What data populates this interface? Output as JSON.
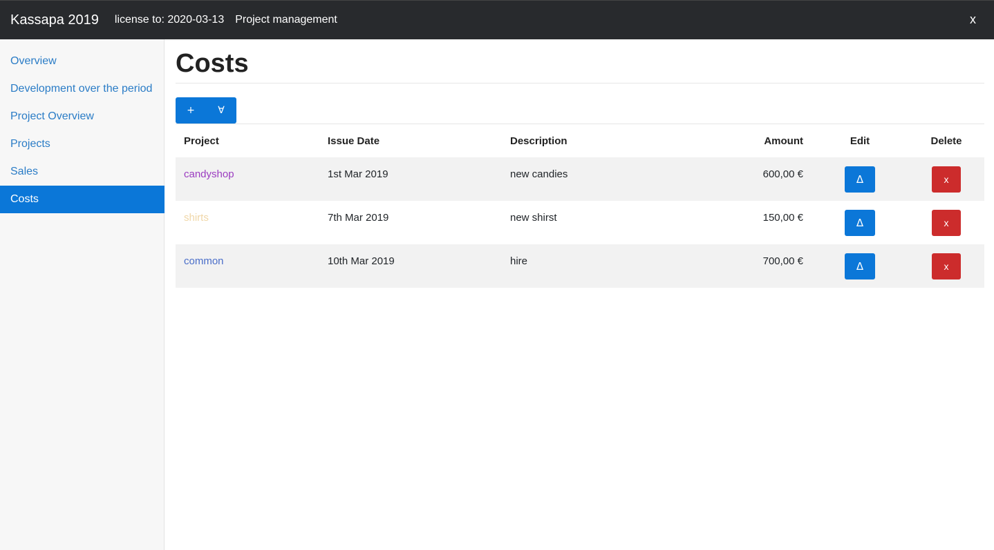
{
  "navbar": {
    "brand": "Kassapa 2019",
    "license": "license to: 2020-03-13",
    "module": "Project management",
    "close_label": "x"
  },
  "sidebar": {
    "items": [
      {
        "label": "Overview"
      },
      {
        "label": "Development over the period"
      },
      {
        "label": "Project Overview"
      },
      {
        "label": "Projects"
      },
      {
        "label": "Sales"
      },
      {
        "label": "Costs",
        "active": true
      }
    ]
  },
  "page": {
    "title": "Costs",
    "add_label": "+",
    "all_label": "∀"
  },
  "table": {
    "headers": {
      "project": "Project",
      "issue_date": "Issue Date",
      "description": "Description",
      "amount": "Amount",
      "edit": "Edit",
      "delete": "Delete"
    },
    "rows": [
      {
        "project": "candyshop",
        "project_color": "#9b3cc0",
        "issue_date": "1st Mar 2019",
        "description": "new candies",
        "amount": "600,00 €",
        "edit_label": "Δ",
        "delete_label": "x"
      },
      {
        "project": "shirts",
        "project_color": "#f0d7a8",
        "issue_date": "7th Mar 2019",
        "description": "new shirst",
        "amount": "150,00 €",
        "edit_label": "Δ",
        "delete_label": "x"
      },
      {
        "project": "common",
        "project_color": "#4a6ec9",
        "issue_date": "10th Mar 2019",
        "description": "hire",
        "amount": "700,00 €",
        "edit_label": "Δ",
        "delete_label": "x"
      }
    ]
  },
  "colors": {
    "accent": "#0b77d8",
    "danger": "#cc2c2c",
    "navbar": "#282a2d"
  }
}
